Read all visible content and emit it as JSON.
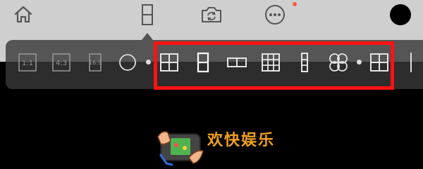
{
  "top_nav": {
    "items": [
      {
        "icon": "home-icon"
      },
      {
        "icon": "phone-portrait-icon",
        "selected": true
      },
      {
        "icon": "switch-camera-icon"
      },
      {
        "icon": "more-icon",
        "has_notification": true
      },
      {
        "icon": "record-button-icon"
      }
    ],
    "notification_color": "#ff5a3c"
  },
  "layout_picker": {
    "ratio_options": [
      {
        "icon": "ratio-1-1-icon",
        "label": "1:1"
      },
      {
        "icon": "ratio-4-3-icon",
        "label": "4:3"
      },
      {
        "icon": "ratio-16-9-icon",
        "label": "16:9"
      },
      {
        "icon": "circle-shape-icon"
      }
    ],
    "grid_options": [
      {
        "icon": "grid-2x2-icon"
      },
      {
        "icon": "split-vertical-2-icon",
        "selected": true
      },
      {
        "icon": "split-horizontal-2-icon"
      },
      {
        "icon": "grid-3x3-icon"
      },
      {
        "icon": "split-vertical-3-icon"
      },
      {
        "icon": "four-circles-icon"
      },
      {
        "icon": "grid-2x2-icon"
      }
    ],
    "highlight_color": "#ff1212"
  },
  "watermark": {
    "logo_icon": "gamepad-hands-icon",
    "text": "欢快娱乐",
    "text_color": "#f0a020"
  }
}
